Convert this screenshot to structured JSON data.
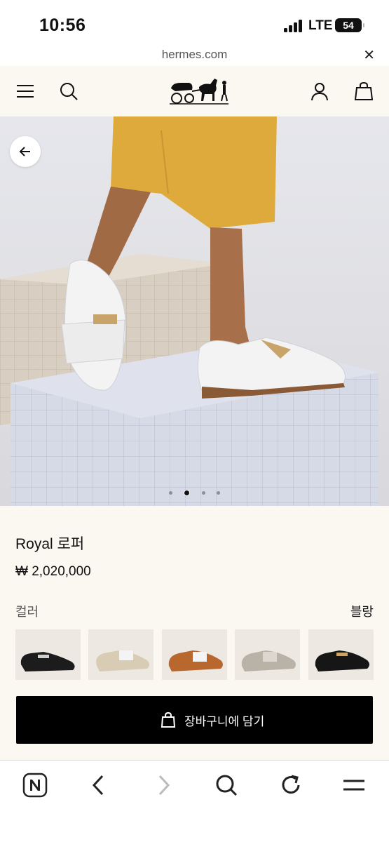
{
  "status_bar": {
    "time": "10:56",
    "network": "LTE",
    "battery": "54"
  },
  "url_bar": {
    "domain": "hermes.com",
    "close_glyph": "✕"
  },
  "header": {
    "icons": [
      "menu-icon",
      "search-icon",
      "hermes-carriage-logo",
      "account-icon",
      "shopping-bag-icon"
    ]
  },
  "hero": {
    "back_icon": "arrow-left-icon",
    "carousel": {
      "slides": 4,
      "active_index": 1
    }
  },
  "product": {
    "title": "Royal 로퍼",
    "price": "₩ 2,020,000",
    "color_label": "컬러",
    "selected_color": "블랑",
    "swatches": [
      {
        "name": "noir",
        "shoe_color": "#1c1c1c"
      },
      {
        "name": "beige-blanc",
        "shoe_color": "#d8ccb4"
      },
      {
        "name": "gold",
        "shoe_color": "#b8672f"
      },
      {
        "name": "gris",
        "shoe_color": "#b9b2a6"
      },
      {
        "name": "noir-2",
        "shoe_color": "#161616"
      }
    ],
    "add_to_cart_label": "장바구니에 담기"
  },
  "browser_toolbar": {
    "icons": [
      "naver-n-icon",
      "back-chevron-icon",
      "forward-chevron-icon",
      "search-icon",
      "reload-icon",
      "menu-icon"
    ]
  },
  "colors": {
    "header_bg": "#fbf8f2",
    "button_bg": "#000000",
    "accent": "#111111"
  }
}
